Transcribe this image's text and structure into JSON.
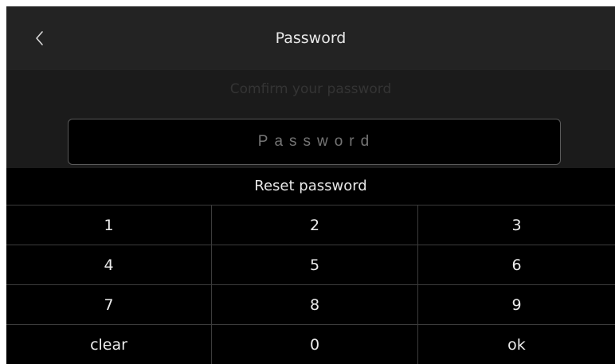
{
  "header": {
    "title": "Password",
    "back_icon": "chevron-left-icon"
  },
  "subtitle": "Comfirm your password",
  "password_field": {
    "placeholder": "Password",
    "value": ""
  },
  "reset_label": "Reset password",
  "keypad": {
    "keys": [
      "1",
      "2",
      "3",
      "4",
      "5",
      "6",
      "7",
      "8",
      "9",
      "clear",
      "0",
      "ok"
    ]
  },
  "colors": {
    "header_bg": "#232323",
    "body_bg": "#1b1b1b",
    "key_bg": "#000000",
    "divider": "#3c3c3c",
    "text": "#e8e8e8"
  }
}
